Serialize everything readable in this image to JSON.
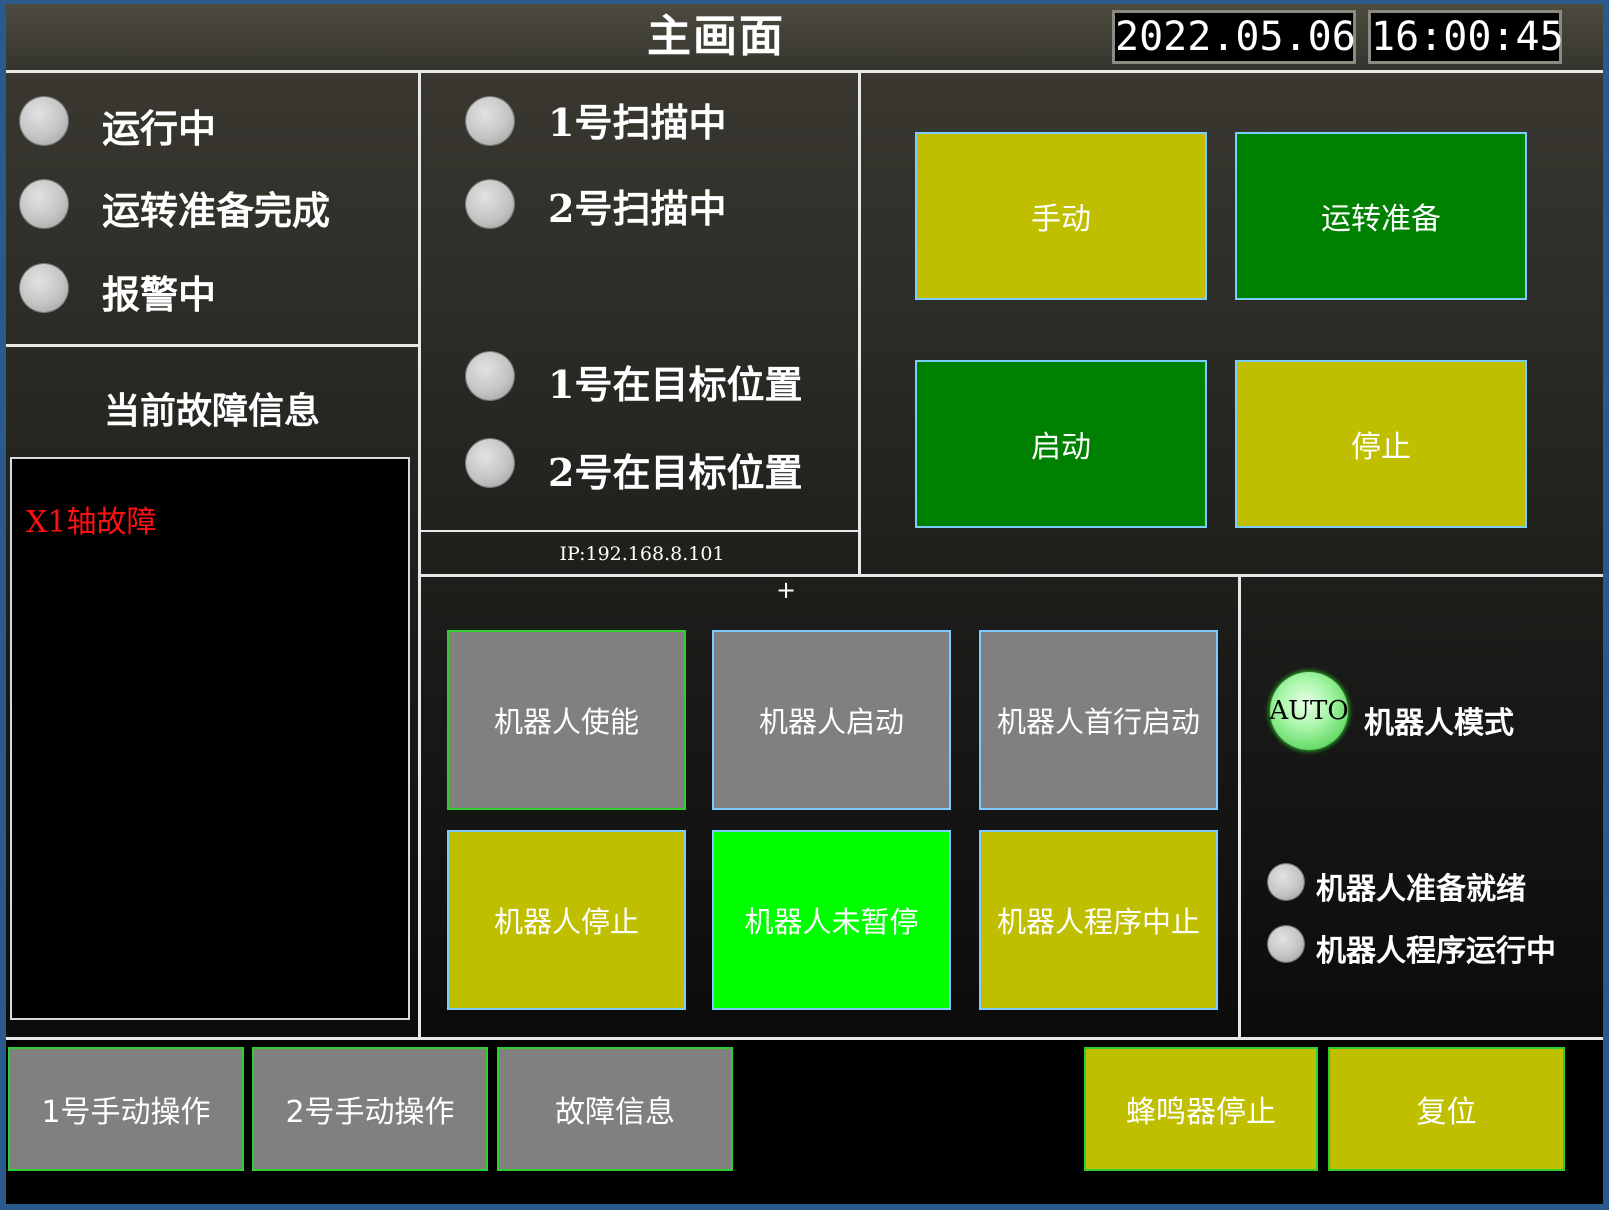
{
  "header": {
    "title": "主画面",
    "date": "2022.05.06",
    "time": "16:00:45"
  },
  "status_panel": {
    "items": [
      {
        "label": "运行中"
      },
      {
        "label": "运转准备完成"
      },
      {
        "label": "报警中"
      }
    ]
  },
  "fault_panel": {
    "heading": "当前故障信息",
    "messages": [
      "X1轴故障"
    ]
  },
  "scanner_panel": {
    "items": [
      {
        "label": "1号扫描中"
      },
      {
        "label": "2号扫描中"
      },
      {
        "label": "1号在目标位置"
      },
      {
        "label": "2号在目标位置"
      }
    ],
    "ip": "IP:192.168.8.101"
  },
  "control_buttons": {
    "manual": "手动",
    "run_prepare": "运转准备",
    "start": "启动",
    "stop": "停止"
  },
  "robot_buttons": {
    "enable": "机器人使能",
    "start": "机器人启动",
    "first_line_start": "机器人首行启动",
    "stop": "机器人停止",
    "not_paused": "机器人未暂停",
    "program_abort": "机器人程序中止"
  },
  "robot_status": {
    "mode_indicator": "AUTO",
    "mode_label": "机器人模式",
    "ready_label": "机器人准备就绪",
    "program_running_label": "机器人程序运行中"
  },
  "bottom_nav": {
    "manual_op_1": "1号手动操作",
    "manual_op_2": "2号手动操作",
    "fault_info": "故障信息",
    "buzzer_stop": "蜂鸣器停止",
    "reset": "复位"
  },
  "colors": {
    "yellow_button": "#bfbf00",
    "dark_green_button": "#008000",
    "bright_green_button": "#00ff00",
    "gray_button": "#808080",
    "fault_text": "#ff1010",
    "lamp_off": "#c4c4c4",
    "lamp_on_green": "#a6f5a6"
  }
}
